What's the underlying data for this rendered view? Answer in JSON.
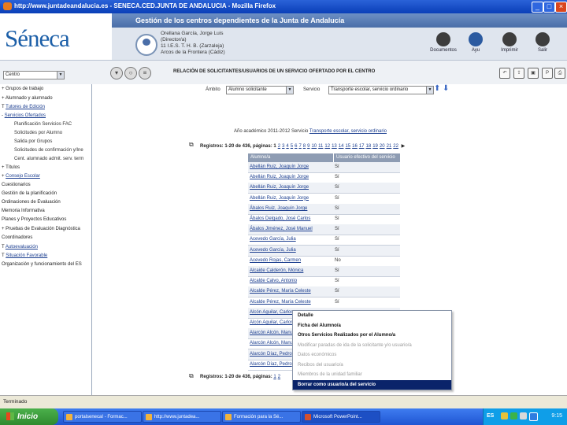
{
  "window": {
    "title": "http://www.juntadeandalucia.es - SENECA.CED.JUNTA DE ANDALUCIA - Mozilla Firefox"
  },
  "header": {
    "logo_text": "Séneca",
    "title": "Gestión de los centros dependientes de la Junta de Andalucía",
    "user": {
      "name": "Orellana García, Jorge Luis",
      "role": "(Director/a)",
      "center": "11 I.E.S. T. H. B. (Zarzaleja)",
      "location": "Arcos de la Frontera (Cádiz)"
    },
    "buttons": [
      {
        "label": "Documentos",
        "icon": "documents-icon"
      },
      {
        "label": "Ayu",
        "icon": "help-icon"
      },
      {
        "label": "Imprimir",
        "icon": "print-icon"
      },
      {
        "label": "Salir",
        "icon": "exit-icon"
      }
    ]
  },
  "toolbar": {
    "center_select": "Centro",
    "section_title": "RELACIÓN DE SOLICITANTES/USUARIOS DE UN SERVICIO OFERTADO POR EL CENTRO"
  },
  "sidebar": {
    "items": [
      {
        "label": "Grupos de trabajo",
        "prefix": "+"
      },
      {
        "label": "Alumnado y alumnado",
        "prefix": "+"
      },
      {
        "label": "Tutores de Edición",
        "prefix": "T"
      },
      {
        "label": "Servicios Ofertados",
        "prefix": "-"
      },
      {
        "label": "Planificación Servicios FAC",
        "sub": true
      },
      {
        "label": "Solicitudes por Alumno",
        "sub": true
      },
      {
        "label": "Salida por Grupos",
        "sub": true
      },
      {
        "label": "Solicitudes de confirmación y/Ine",
        "sub": true
      },
      {
        "label": "Cent. alumnado admit. serv. term",
        "sub": true
      },
      {
        "label": "Títulos",
        "prefix": "+"
      },
      {
        "label": "Consejo Escolar",
        "prefix": "+"
      },
      {
        "label": "Cuestionarios"
      },
      {
        "label": "Gestión de la planificación"
      },
      {
        "label": "Ordinaciones de Evaluación"
      },
      {
        "label": "Memoria Informativa"
      },
      {
        "label": "Planes y Proyectos Educativos"
      },
      {
        "label": "Pruebas de Evaluación Diagnóstica",
        "prefix": "+"
      },
      {
        "label": "Coordinadores"
      },
      {
        "label": "Autoevaluación",
        "prefix": "T"
      },
      {
        "label": "Situación Favorable",
        "prefix": "T"
      },
      {
        "label": "Organización y funcionamiento del ES"
      }
    ]
  },
  "filters": {
    "ambito_label": "Ámbito",
    "ambito_value": "Alumno solicitante",
    "servicio_label": "Servicio",
    "servicio_value": "Transporte escolar, servicio ordinario",
    "curso_text": "Año académico 2011-2012 Servicio",
    "curso_link": "Transporte escolar, servicio ordinario"
  },
  "pager": {
    "prefix": "Registros: 1-20 de 436, páginas:",
    "pages": [
      "1",
      "2",
      "3",
      "4",
      "5",
      "6",
      "7",
      "8",
      "9",
      "10",
      "11",
      "12",
      "13",
      "14",
      "15",
      "16",
      "17",
      "18",
      "19",
      "20",
      "21",
      "22"
    ]
  },
  "table": {
    "headers": [
      "Alumno/a",
      "Usuario efectivo del servicio"
    ],
    "rows": [
      [
        "Abellán Ruiz, Joaquín Jorge",
        "Sí"
      ],
      [
        "Abellán Ruiz, Joaquín Jorge",
        "Sí"
      ],
      [
        "Abellán Ruiz, Joaquín Jorge",
        "Sí"
      ],
      [
        "Abellán Ruiz, Joaquín Jorge",
        "Sí"
      ],
      [
        "Ábalos Ruiz, Joaquín Jorge",
        "Sí"
      ],
      [
        "Ábalos Delgado, José Carlos",
        "Sí"
      ],
      [
        "Ábalos Jiménez, José Manuel",
        "Sí"
      ],
      [
        "Acevedo García, Julia",
        "Sí"
      ],
      [
        "Acevedo García, Julia",
        "Sí"
      ],
      [
        "Acevedo Rojas, Carmen",
        "No"
      ],
      [
        "Alcaide Calderón, Mónica",
        "Sí"
      ],
      [
        "Alcalde Calvo, Antonio",
        "Sí"
      ],
      [
        "Alcalde Pérez, María Celeste",
        "Sí"
      ],
      [
        "Alcalde Pérez, María Celeste",
        "Sí"
      ],
      [
        "Alcón Aguilar, Carlos",
        ""
      ],
      [
        "Alcón Aguilar, Carlos",
        ""
      ],
      [
        "Alarcón Alcón, Manuel",
        ""
      ],
      [
        "Alarcón Alcón, Manuel",
        ""
      ],
      [
        "Alarcón Díaz, Pedro",
        ""
      ],
      [
        "Alarcón Díaz, Pedro",
        ""
      ]
    ]
  },
  "context_menu": {
    "items": [
      {
        "label": "Detalle",
        "state": "enabled"
      },
      {
        "label": "Ficha del Alumno/a",
        "state": "enabled"
      },
      {
        "label": "Otros Servicios Realizados por el Alumno/a",
        "state": "enabled"
      },
      {
        "label": "Modificar paradas de ida de la solicitante y/o usuario/a",
        "state": "disabled"
      },
      {
        "label": "Datos económicos",
        "state": "disabled"
      },
      {
        "label": "Recibos del usuario/a",
        "state": "disabled"
      },
      {
        "label": "Miembros de la unidad familiar",
        "state": "disabled"
      },
      {
        "label": "Borrar como usuario/a del servicio",
        "state": "highlighted"
      }
    ]
  },
  "statusbar": {
    "text": "Terminado"
  },
  "taskbar": {
    "start": "Inicio",
    "tasks": [
      "portalsenecaI - Formac...",
      "http://www.juntadea...",
      "Formación para la Sé...",
      "Microsoft PowerPoint..."
    ],
    "lang": "ES",
    "clock": "9:15"
  }
}
